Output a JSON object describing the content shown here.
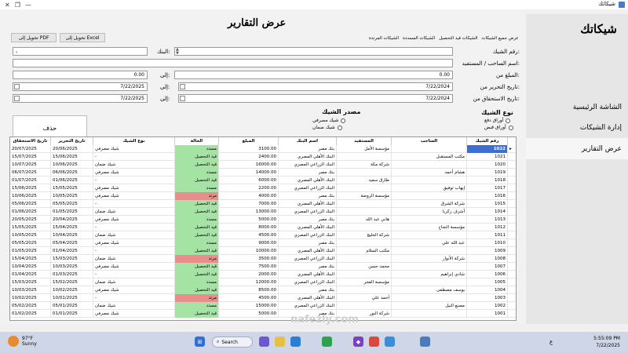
{
  "window": {
    "title": "شيكاتك",
    "controls": [
      "—",
      "❐",
      "✕"
    ]
  },
  "sidebar": {
    "brand": "شيكاتك",
    "items": [
      "الشاشة الرئيسية",
      "إدارة الشيكات",
      "عرض التقارير"
    ]
  },
  "main": {
    "title": "عرض التقارير",
    "export_excel": "تحويل إلى Excel",
    "export_pdf": "تحويل إلى PDF",
    "tabs": [
      "عرض جميع الشيكات",
      "الشيكات قيد التحصيل",
      "الشيكات المسددة",
      "الشيكات المرتدة"
    ],
    "filters": {
      "check_number_label": "رقم الشيك:",
      "drawer_label": "اسم الساحب / المستفيد:",
      "bank_label": "البنك:",
      "amount_from_label": "المبلغ من:",
      "amount_from": "0.00",
      "amount_to_label": "إلى:",
      "amount_to": "0.00",
      "issue_from_label": "تاريخ التحرير من:",
      "issue_from": "7/22/2024",
      "issue_to_label": "إلى:",
      "issue_to": "7/22/2025",
      "due_from_label": "تاريخ الاستحقاق من:",
      "due_from": "7/22/2024",
      "due_to_label": "إلى:",
      "due_to": "7/22/2025"
    },
    "delete_label": "حذف",
    "source_group": {
      "title": "مصدر الشيك",
      "options": [
        "شيك مصرفي",
        "شيك ضمان"
      ]
    },
    "type_group": {
      "title": "نوع الشيك",
      "options": [
        "أوراق دفع",
        "أوراق قبض"
      ]
    }
  },
  "table": {
    "headers": {
      "num": "رقم الشيك",
      "drawer": "الساحب",
      "payee": "المستفيد",
      "bank": "اسم البنك",
      "amount": "المبلغ",
      "status": "الحالة",
      "type": "نوع الشيك",
      "issue": "تاريخ التحرير",
      "due": "تاريخ الاستحقاق"
    },
    "rows": [
      {
        "num": "1022",
        "drawer": "",
        "payee": "مؤسسة الأمل",
        "bank": "بنك مصر",
        "amount": "3100.00",
        "status": "مسدد",
        "type": "شيك مصرفي",
        "issue": "20/06/2025",
        "due": "20/07/2025",
        "sc": "green"
      },
      {
        "num": "1021",
        "drawer": "مكتب المستقبل",
        "payee": "",
        "bank": "البنك الأهلي المصري",
        "amount": "2400.00",
        "status": "قيد التحصيل",
        "type": "-",
        "issue": "15/06/2025",
        "due": "15/07/2025",
        "sc": "green"
      },
      {
        "num": "1020",
        "drawer": "",
        "payee": "شركة مكة",
        "bank": "البنك الزراعي المصري",
        "amount": "16000.00",
        "status": "قيد التحصيل",
        "type": "شيك ضمان",
        "issue": "10/06/2025",
        "due": "10/07/2025",
        "sc": "green"
      },
      {
        "num": "1019",
        "drawer": "هشام أحمد",
        "payee": "",
        "bank": "بنك مصر",
        "amount": "14000.00",
        "status": "مسدد",
        "type": "شيك مصرفي",
        "issue": "06/06/2025",
        "due": "06/07/2025",
        "sc": "green"
      },
      {
        "num": "1018",
        "drawer": "",
        "payee": "طارق سعيد",
        "bank": "البنك الأهلي المصري",
        "amount": "6000.00",
        "status": "قيد التحصيل",
        "type": "-",
        "issue": "01/06/2025",
        "due": "01/07/2025",
        "sc": "green"
      },
      {
        "num": "1017",
        "drawer": "إيهاب توفيق",
        "payee": "",
        "bank": "البنك الزراعي المصري",
        "amount": "2200.00",
        "status": "مسدد",
        "type": "شيك مصرفي",
        "issue": "15/05/2025",
        "due": "15/06/2025",
        "sc": "green"
      },
      {
        "num": "1016",
        "drawer": "",
        "payee": "مؤسسة الروضة",
        "bank": "بنك مصر",
        "amount": "4000.00",
        "status": "مرتد",
        "type": "شيك مصرفي",
        "issue": "10/05/2025",
        "due": "10/06/2025",
        "sc": "red"
      },
      {
        "num": "1015",
        "drawer": "شركة الشرق",
        "payee": "",
        "bank": "البنك الأهلي المصري",
        "amount": "7000.00",
        "status": "قيد التحصيل",
        "type": "-",
        "issue": "05/05/2025",
        "due": "05/06/2025",
        "sc": "green"
      },
      {
        "num": "1014",
        "drawer": "أشرف زكريا",
        "payee": "",
        "bank": "البنك الزراعي المصري",
        "amount": "13000.00",
        "status": "قيد التحصيل",
        "type": "شيك ضمان",
        "issue": "01/05/2025",
        "due": "01/06/2025",
        "sc": "green"
      },
      {
        "num": "1013",
        "drawer": "",
        "payee": "هاني عبد الله",
        "bank": "بنك مصر",
        "amount": "5000.00",
        "status": "مسدد",
        "type": "شيك مصرفي",
        "issue": "20/04/2025",
        "due": "20/05/2025",
        "sc": "green"
      },
      {
        "num": "1012",
        "drawer": "مؤسسة النجاح",
        "payee": "",
        "bank": "البنك الأهلي المصري",
        "amount": "8000.00",
        "status": "قيد التحصيل",
        "type": "-",
        "issue": "15/04/2025",
        "due": "15/05/2025",
        "sc": "green"
      },
      {
        "num": "1011",
        "drawer": "",
        "payee": "شركة الخليج",
        "bank": "البنك الزراعي المصري",
        "amount": "4500.00",
        "status": "قيد التحصيل",
        "type": "شيك ضمان",
        "issue": "10/04/2025",
        "due": "10/05/2025",
        "sc": "green"
      },
      {
        "num": "1010",
        "drawer": "عبد الله علي",
        "payee": "",
        "bank": "بنك مصر",
        "amount": "9000.00",
        "status": "مسدد",
        "type": "شيك مصرفي",
        "issue": "05/04/2025",
        "due": "05/05/2025",
        "sc": "green"
      },
      {
        "num": "1009",
        "drawer": "",
        "payee": "مكتب السلام",
        "bank": "البنك الأهلي المصري",
        "amount": "10000.00",
        "status": "قيد التحصيل",
        "type": "-",
        "issue": "01/04/2025",
        "due": "01/05/2025",
        "sc": "green"
      },
      {
        "num": "1008",
        "drawer": "شركة الأنوار",
        "payee": "",
        "bank": "البنك الزراعي المصري",
        "amount": "3500.00",
        "status": "مرتد",
        "type": "شيك ضمان",
        "issue": "15/03/2025",
        "due": "15/04/2025",
        "sc": "red"
      },
      {
        "num": "1007",
        "drawer": "",
        "payee": "محمد حسن",
        "bank": "بنك مصر",
        "amount": "7500.00",
        "status": "قيد التحصيل",
        "type": "شيك مصرفي",
        "issue": "10/03/2025",
        "due": "10/04/2025",
        "sc": "green"
      },
      {
        "num": "1006",
        "drawer": "شادي إبراهيم",
        "payee": "",
        "bank": "البنك الأهلي المصري",
        "amount": "2000.00",
        "status": "قيد التحصيل",
        "type": "-",
        "issue": "01/03/2025",
        "due": "01/04/2025",
        "sc": "green"
      },
      {
        "num": "1005",
        "drawer": "",
        "payee": "مؤسسة الفجر",
        "bank": "البنك الزراعي المصري",
        "amount": "12000.00",
        "status": "مسدد",
        "type": "شيك ضمان",
        "issue": "15/02/2025",
        "due": "15/03/2025",
        "sc": "green"
      },
      {
        "num": "1004",
        "drawer": "يوسف مصطفى",
        "payee": "",
        "bank": "بنك مصر",
        "amount": "8500.00",
        "status": "قيد التحصيل",
        "type": "شيك مصرفي",
        "issue": "10/02/2025",
        "due": "10/03/2025",
        "sc": "green"
      },
      {
        "num": "1003",
        "drawer": "",
        "payee": "أحمد علي",
        "bank": "البنك الأهلي المصري",
        "amount": "4500.00",
        "status": "مرتد",
        "type": "-",
        "issue": "10/01/2025",
        "due": "10/02/2025",
        "sc": "red"
      },
      {
        "num": "1002",
        "drawer": "مصنع النيل",
        "payee": "",
        "bank": "البنك الزراعي المصري",
        "amount": "15000.00",
        "status": "مسدد",
        "type": "شيك ضمان",
        "issue": "05/01/2025",
        "due": "05/02/2025",
        "sc": "green"
      },
      {
        "num": "1001",
        "drawer": "",
        "payee": "شركة النور",
        "bank": "بنك مصر",
        "amount": "5000.00",
        "status": "قيد التحصيل",
        "type": "شيك مصرفي",
        "issue": "01/01/2025",
        "due": "01/02/2025",
        "sc": "green"
      }
    ]
  },
  "taskbar": {
    "temp": "97°F",
    "weather": "Sunny",
    "badge": "4",
    "search": "Search",
    "time": "5:55:09 PM",
    "date": "7/22/2025",
    "lang": "ع"
  },
  "watermark": "nafezly.com",
  "colors": {
    "green": "#a4e3a4",
    "red": "#e98d8d",
    "selected": "#3d6fd0"
  }
}
